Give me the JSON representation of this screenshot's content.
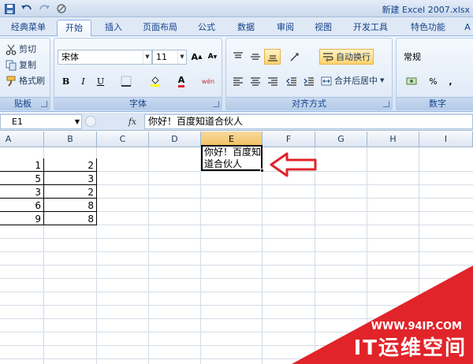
{
  "window": {
    "title": "新建 Excel 2007.xlsx"
  },
  "quick_access": {
    "icons": [
      "save-icon",
      "undo-icon",
      "redo-icon",
      "paste-special-icon"
    ]
  },
  "tabs": [
    "经典菜单",
    "开始",
    "插入",
    "页面布局",
    "公式",
    "数据",
    "审阅",
    "视图",
    "开发工具",
    "特色功能",
    "A"
  ],
  "active_tab": "开始",
  "ribbon": {
    "clipboard": {
      "label": "贴板",
      "cut": "剪切",
      "copy": "复制",
      "format_painter": "格式刷"
    },
    "font": {
      "label": "字体",
      "font_name": "宋体",
      "font_size": "11",
      "grow": "A",
      "shrink": "A",
      "bold": "B",
      "italic": "I",
      "underline": "U",
      "font_color_glyph": "A",
      "phonetic_glyph": "wén"
    },
    "alignment": {
      "label": "对齐方式",
      "wrap_text": "自动换行",
      "merge_center": "合并后居中"
    },
    "number": {
      "label": "数字",
      "format": "常规",
      "percent": "%",
      "comma": ","
    }
  },
  "formula_bar": {
    "name_box": "E1",
    "fx": "fx",
    "content": "你好！百度知道合伙人"
  },
  "sheet": {
    "columns": [
      "A",
      "B",
      "C",
      "D",
      "E",
      "F",
      "G",
      "H",
      "I"
    ],
    "active_column": "E",
    "rows": [
      {
        "a": "1",
        "b": "2"
      },
      {
        "a": "5",
        "b": "3"
      },
      {
        "a": "3",
        "b": "2"
      },
      {
        "a": "6",
        "b": "8"
      },
      {
        "a": "9",
        "b": "8"
      }
    ],
    "e1_text": "你好！百度知道合伙人"
  },
  "annotation": {
    "arrow_color": "#e0242a"
  },
  "watermark": {
    "url": "WWW.94IP.COM",
    "brand": "IT运维空间",
    "color": "#e0242a"
  }
}
